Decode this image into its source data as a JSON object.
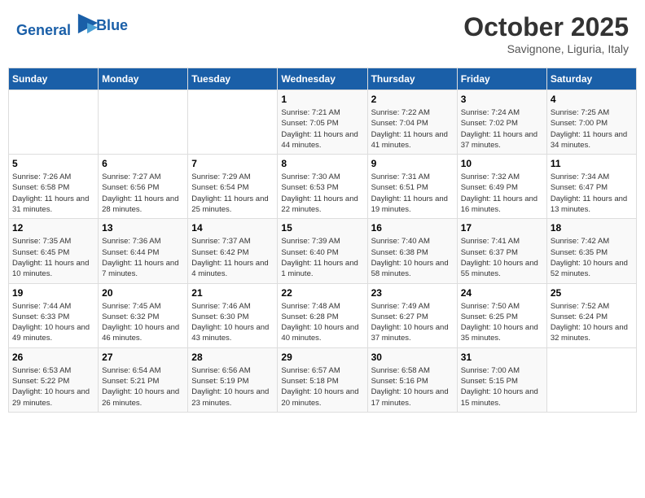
{
  "header": {
    "logo_line1": "General",
    "logo_line2": "Blue",
    "month": "October 2025",
    "location": "Savignone, Liguria, Italy"
  },
  "days_of_week": [
    "Sunday",
    "Monday",
    "Tuesday",
    "Wednesday",
    "Thursday",
    "Friday",
    "Saturday"
  ],
  "weeks": [
    [
      {
        "day": "",
        "info": ""
      },
      {
        "day": "",
        "info": ""
      },
      {
        "day": "",
        "info": ""
      },
      {
        "day": "1",
        "info": "Sunrise: 7:21 AM\nSunset: 7:05 PM\nDaylight: 11 hours and 44 minutes."
      },
      {
        "day": "2",
        "info": "Sunrise: 7:22 AM\nSunset: 7:04 PM\nDaylight: 11 hours and 41 minutes."
      },
      {
        "day": "3",
        "info": "Sunrise: 7:24 AM\nSunset: 7:02 PM\nDaylight: 11 hours and 37 minutes."
      },
      {
        "day": "4",
        "info": "Sunrise: 7:25 AM\nSunset: 7:00 PM\nDaylight: 11 hours and 34 minutes."
      }
    ],
    [
      {
        "day": "5",
        "info": "Sunrise: 7:26 AM\nSunset: 6:58 PM\nDaylight: 11 hours and 31 minutes."
      },
      {
        "day": "6",
        "info": "Sunrise: 7:27 AM\nSunset: 6:56 PM\nDaylight: 11 hours and 28 minutes."
      },
      {
        "day": "7",
        "info": "Sunrise: 7:29 AM\nSunset: 6:54 PM\nDaylight: 11 hours and 25 minutes."
      },
      {
        "day": "8",
        "info": "Sunrise: 7:30 AM\nSunset: 6:53 PM\nDaylight: 11 hours and 22 minutes."
      },
      {
        "day": "9",
        "info": "Sunrise: 7:31 AM\nSunset: 6:51 PM\nDaylight: 11 hours and 19 minutes."
      },
      {
        "day": "10",
        "info": "Sunrise: 7:32 AM\nSunset: 6:49 PM\nDaylight: 11 hours and 16 minutes."
      },
      {
        "day": "11",
        "info": "Sunrise: 7:34 AM\nSunset: 6:47 PM\nDaylight: 11 hours and 13 minutes."
      }
    ],
    [
      {
        "day": "12",
        "info": "Sunrise: 7:35 AM\nSunset: 6:45 PM\nDaylight: 11 hours and 10 minutes."
      },
      {
        "day": "13",
        "info": "Sunrise: 7:36 AM\nSunset: 6:44 PM\nDaylight: 11 hours and 7 minutes."
      },
      {
        "day": "14",
        "info": "Sunrise: 7:37 AM\nSunset: 6:42 PM\nDaylight: 11 hours and 4 minutes."
      },
      {
        "day": "15",
        "info": "Sunrise: 7:39 AM\nSunset: 6:40 PM\nDaylight: 11 hours and 1 minute."
      },
      {
        "day": "16",
        "info": "Sunrise: 7:40 AM\nSunset: 6:38 PM\nDaylight: 10 hours and 58 minutes."
      },
      {
        "day": "17",
        "info": "Sunrise: 7:41 AM\nSunset: 6:37 PM\nDaylight: 10 hours and 55 minutes."
      },
      {
        "day": "18",
        "info": "Sunrise: 7:42 AM\nSunset: 6:35 PM\nDaylight: 10 hours and 52 minutes."
      }
    ],
    [
      {
        "day": "19",
        "info": "Sunrise: 7:44 AM\nSunset: 6:33 PM\nDaylight: 10 hours and 49 minutes."
      },
      {
        "day": "20",
        "info": "Sunrise: 7:45 AM\nSunset: 6:32 PM\nDaylight: 10 hours and 46 minutes."
      },
      {
        "day": "21",
        "info": "Sunrise: 7:46 AM\nSunset: 6:30 PM\nDaylight: 10 hours and 43 minutes."
      },
      {
        "day": "22",
        "info": "Sunrise: 7:48 AM\nSunset: 6:28 PM\nDaylight: 10 hours and 40 minutes."
      },
      {
        "day": "23",
        "info": "Sunrise: 7:49 AM\nSunset: 6:27 PM\nDaylight: 10 hours and 37 minutes."
      },
      {
        "day": "24",
        "info": "Sunrise: 7:50 AM\nSunset: 6:25 PM\nDaylight: 10 hours and 35 minutes."
      },
      {
        "day": "25",
        "info": "Sunrise: 7:52 AM\nSunset: 6:24 PM\nDaylight: 10 hours and 32 minutes."
      }
    ],
    [
      {
        "day": "26",
        "info": "Sunrise: 6:53 AM\nSunset: 5:22 PM\nDaylight: 10 hours and 29 minutes."
      },
      {
        "day": "27",
        "info": "Sunrise: 6:54 AM\nSunset: 5:21 PM\nDaylight: 10 hours and 26 minutes."
      },
      {
        "day": "28",
        "info": "Sunrise: 6:56 AM\nSunset: 5:19 PM\nDaylight: 10 hours and 23 minutes."
      },
      {
        "day": "29",
        "info": "Sunrise: 6:57 AM\nSunset: 5:18 PM\nDaylight: 10 hours and 20 minutes."
      },
      {
        "day": "30",
        "info": "Sunrise: 6:58 AM\nSunset: 5:16 PM\nDaylight: 10 hours and 17 minutes."
      },
      {
        "day": "31",
        "info": "Sunrise: 7:00 AM\nSunset: 5:15 PM\nDaylight: 10 hours and 15 minutes."
      },
      {
        "day": "",
        "info": ""
      }
    ]
  ]
}
